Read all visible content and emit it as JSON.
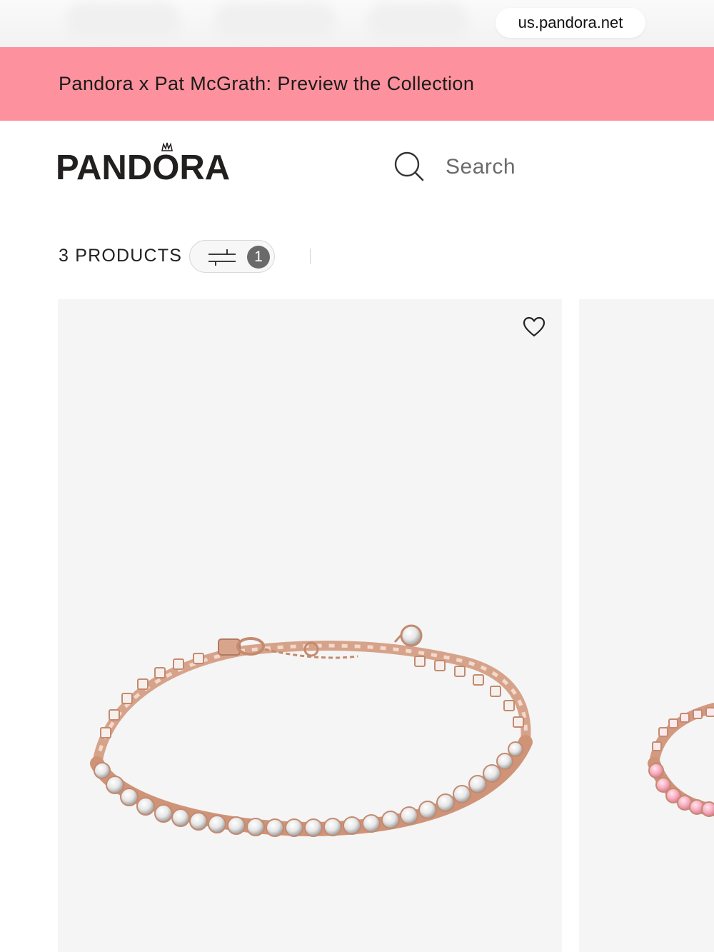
{
  "browser": {
    "url": "us.pandora.net"
  },
  "promo_banner": {
    "text": "Pandora x Pat McGrath: Preview the Collection",
    "background": "#fd919d"
  },
  "header": {
    "logo_text": "PANDORA",
    "search": {
      "icon": "search-icon",
      "placeholder": "Search"
    }
  },
  "toolbar": {
    "product_count": "3 PRODUCTS",
    "filter_icon": "sliders-icon",
    "active_filter_count": "1"
  },
  "products": [
    {
      "image": "rose-gold tennis bracelet with clear stones",
      "wishlist_icon": "heart-icon"
    },
    {
      "image": "rose-gold tennis bracelet with pink stones"
    }
  ]
}
